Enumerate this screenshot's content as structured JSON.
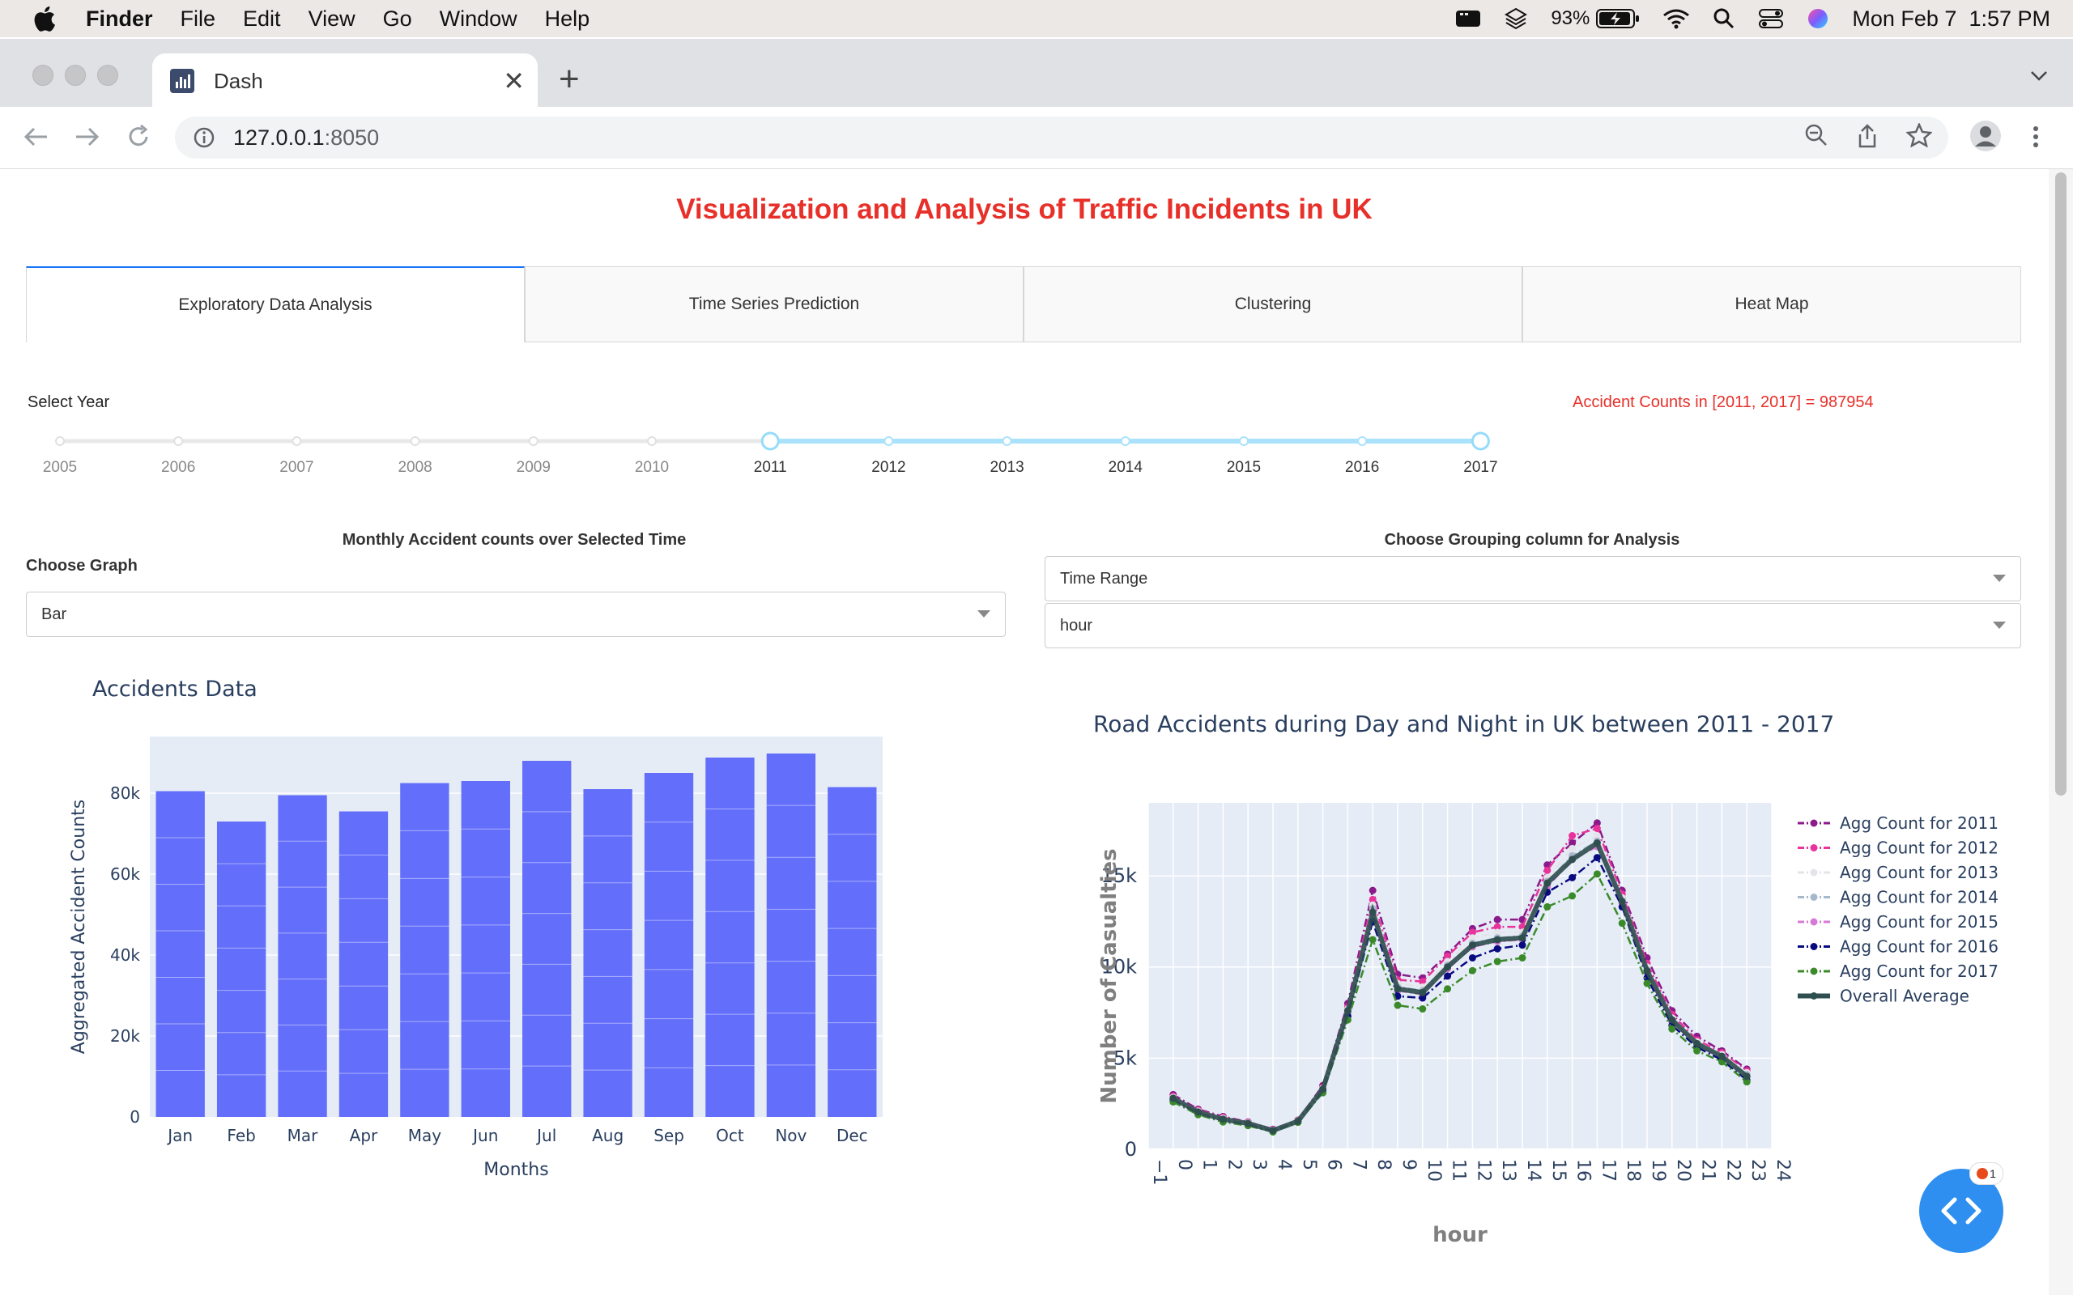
{
  "menubar": {
    "app": "Finder",
    "items": [
      "File",
      "Edit",
      "View",
      "Go",
      "Window",
      "Help"
    ],
    "battery": "93%",
    "datetime": "Mon Feb 7  1:57 PM"
  },
  "browser": {
    "tab_title": "Dash",
    "url_host": "127.0.0.1",
    "url_port": ":8050"
  },
  "page": {
    "title": "Visualization and Analysis of Traffic Incidents in UK",
    "tabs": [
      "Exploratory Data Analysis",
      "Time Series Prediction",
      "Clustering",
      "Heat Map"
    ],
    "select_year_label": "Select Year",
    "years": [
      "2005",
      "2006",
      "2007",
      "2008",
      "2009",
      "2010",
      "2011",
      "2012",
      "2013",
      "2014",
      "2015",
      "2016",
      "2017"
    ],
    "selected_range": [
      2011,
      2017
    ],
    "accident_counts_text": "Accident Counts in [2011, 2017] = 987954",
    "monthly_label": "Monthly Accident counts over Selected Time",
    "choose_graph_label": "Choose Graph",
    "graph_value": "Bar",
    "grouping_label": "Choose Grouping column for Analysis",
    "grouping_value_1": "Time Range",
    "grouping_value_2": "hour",
    "fab_badge": "1"
  },
  "chart_data": [
    {
      "type": "bar",
      "title": "Accidents Data",
      "xlabel": "Months",
      "ylabel": "Aggregated Accident Counts",
      "categories": [
        "Jan",
        "Feb",
        "Mar",
        "Apr",
        "May",
        "Jun",
        "Jul",
        "Aug",
        "Sep",
        "Oct",
        "Nov",
        "Dec"
      ],
      "values": [
        80500,
        73000,
        79500,
        75500,
        82500,
        83000,
        88000,
        81000,
        85000,
        88800,
        89800,
        81500
      ],
      "ylim": [
        0,
        94000
      ],
      "yticks": [
        0,
        20000,
        40000,
        60000,
        80000
      ],
      "ytick_labels": [
        "0",
        "20k",
        "40k",
        "60k",
        "80k"
      ],
      "color": "#636efa"
    },
    {
      "type": "line",
      "title": "Road Accidents during Day and Night in UK between 2011 - 2017",
      "xlabel": "hour",
      "ylabel": "Number of Casualties",
      "x": [
        0,
        1,
        2,
        3,
        4,
        5,
        6,
        7,
        8,
        9,
        10,
        11,
        12,
        13,
        14,
        15,
        16,
        17,
        18,
        19,
        20,
        21,
        22,
        23
      ],
      "xlim": [
        -1,
        24
      ],
      "ylim": [
        0,
        19000
      ],
      "yticks": [
        0,
        5000,
        10000,
        15000
      ],
      "ytick_labels": [
        "0",
        "5k",
        "10k",
        "15k"
      ],
      "xtick_labels": [
        "−1",
        "0",
        "1",
        "2",
        "3",
        "4",
        "5",
        "6",
        "7",
        "8",
        "9",
        "10",
        "11",
        "12",
        "13",
        "14",
        "15",
        "16",
        "17",
        "18",
        "19",
        "20",
        "21",
        "22",
        "23",
        "24"
      ],
      "legend_position": "right",
      "series": [
        {
          "name": "Agg Count for 2011",
          "color": "#8b1a8b",
          "dash": "dashdot",
          "values": [
            3000,
            2200,
            1800,
            1500,
            1100,
            1600,
            3500,
            8000,
            14200,
            9600,
            9400,
            10700,
            12100,
            12600,
            12600,
            15600,
            16800,
            17900,
            14200,
            10500,
            7600,
            6200,
            5400,
            4400
          ]
        },
        {
          "name": "Agg Count for 2012",
          "color": "#e8339a",
          "dash": "dashdot",
          "values": [
            2900,
            2150,
            1750,
            1480,
            1080,
            1580,
            3400,
            7800,
            13700,
            9300,
            9200,
            10600,
            11900,
            12200,
            12200,
            15300,
            17200,
            17600,
            14000,
            10200,
            7400,
            6000,
            5300,
            4300
          ]
        },
        {
          "name": "Agg Count for 2013",
          "color": "#e4e4ea",
          "dash": "dashdot",
          "values": [
            2850,
            2100,
            1700,
            1450,
            1050,
            1560,
            3350,
            7700,
            13400,
            9100,
            8900,
            10300,
            11600,
            11900,
            11900,
            14900,
            16500,
            17200,
            13800,
            10000,
            7200,
            5900,
            5200,
            4200
          ]
        },
        {
          "name": "Agg Count for 2014",
          "color": "#a8b8cc",
          "dash": "dashdot",
          "values": [
            2800,
            2050,
            1650,
            1420,
            1020,
            1540,
            3300,
            7600,
            13200,
            8900,
            8700,
            10100,
            11300,
            11600,
            11700,
            14700,
            16100,
            16900,
            13600,
            9800,
            7100,
            5800,
            5100,
            4100
          ]
        },
        {
          "name": "Agg Count for 2015",
          "color": "#d67ad6",
          "dash": "dashdot",
          "values": [
            2750,
            2000,
            1620,
            1400,
            1000,
            1520,
            3250,
            7500,
            12900,
            8700,
            8500,
            9900,
            11100,
            11400,
            11500,
            14400,
            15900,
            16600,
            13500,
            9700,
            7000,
            5700,
            5000,
            4000
          ]
        },
        {
          "name": "Agg Count for 2016",
          "color": "#0a0a80",
          "dash": "dashdot",
          "values": [
            2700,
            1950,
            1580,
            1350,
            980,
            1500,
            3200,
            7300,
            12500,
            8400,
            8300,
            9500,
            10500,
            11000,
            11200,
            14100,
            14900,
            16000,
            13300,
            9400,
            6800,
            5600,
            4900,
            3800
          ]
        },
        {
          "name": "Agg Count for 2017",
          "color": "#3a8a2a",
          "dash": "dashdot",
          "values": [
            2600,
            1900,
            1500,
            1300,
            950,
            1480,
            3100,
            7100,
            11500,
            7900,
            7700,
            8800,
            9800,
            10300,
            10500,
            13300,
            13900,
            15100,
            12400,
            9100,
            6600,
            5400,
            4800,
            3700
          ]
        },
        {
          "name": "Overall Average",
          "color": "#2f4f4f",
          "dash": "solid",
          "values": [
            2800,
            2050,
            1650,
            1420,
            1030,
            1540,
            3300,
            7600,
            13000,
            8800,
            8600,
            10000,
            11200,
            11500,
            11600,
            14600,
            15900,
            16800,
            13600,
            9800,
            7100,
            5800,
            5100,
            4000
          ]
        }
      ]
    }
  ]
}
